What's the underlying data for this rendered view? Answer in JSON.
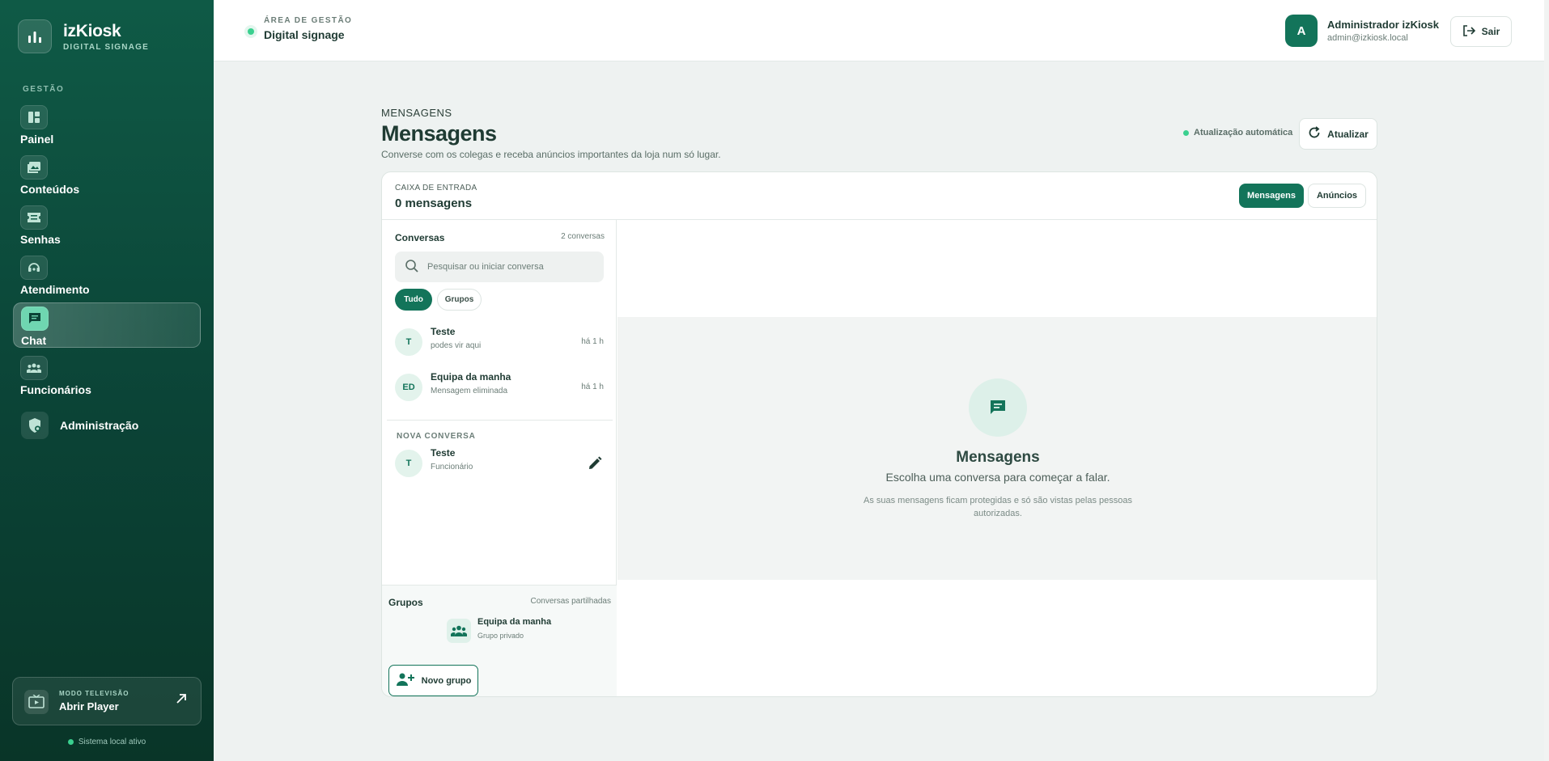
{
  "brand": {
    "name": "izKiosk",
    "subtitle": "DIGITAL SIGNAGE"
  },
  "sidebar": {
    "section_label": "GESTÃO",
    "items": [
      {
        "label": "Painel",
        "icon": "dashboard-icon"
      },
      {
        "label": "Conteúdos",
        "icon": "image-icon"
      },
      {
        "label": "Senhas",
        "icon": "ticket-icon"
      },
      {
        "label": "Atendimento",
        "icon": "headset-icon"
      },
      {
        "label": "Chat",
        "icon": "chat-icon",
        "active": true
      },
      {
        "label": "Funcionários",
        "icon": "people-icon"
      }
    ],
    "admin_label": "Administração",
    "player": {
      "kicker": "MODO TELEVISÃO",
      "label": "Abrir Player"
    },
    "system_status": "Sistema local ativo"
  },
  "topbar": {
    "area_kicker": "ÁREA DE GESTÃO",
    "area_title": "Digital signage",
    "user": {
      "initial": "A",
      "name": "Administrador izKiosk",
      "email": "admin@izkiosk.local"
    },
    "logout_label": "Sair"
  },
  "page": {
    "breadcrumb": "MENSAGENS",
    "title": "Mensagens",
    "subtitle": "Converse com os colegas e receba anúncios importantes da loja num só lugar.",
    "auto_update": "Atualização automática",
    "refresh_label": "Atualizar"
  },
  "inbox": {
    "kicker": "CAIXA DE ENTRADA",
    "count": "0 mensagens",
    "tabs": [
      "Mensagens",
      "Anúncios"
    ]
  },
  "conversations": {
    "title": "Conversas",
    "count": "2 conversas",
    "search_placeholder": "Pesquisar ou iniciar conversa",
    "filters": [
      "Tudo",
      "Grupos"
    ],
    "items": [
      {
        "initials": "T",
        "name": "Teste",
        "preview": "podes vir aqui",
        "time": "há 1 h"
      },
      {
        "initials": "ED",
        "name": "Equipa da manha",
        "preview": "Mensagem eliminada",
        "time": "há 1 h"
      }
    ],
    "new_label": "NOVA CONVERSA",
    "new_items": [
      {
        "initials": "T",
        "name": "Teste",
        "role": "Funcionário"
      }
    ]
  },
  "groups": {
    "title": "Grupos",
    "caption": "Conversas partilhadas",
    "items": [
      {
        "name": "Equipa da manha",
        "type": "Grupo privado"
      }
    ],
    "new_label": "Novo grupo"
  },
  "empty_state": {
    "title": "Mensagens",
    "subtitle": "Escolha uma conversa para começar a falar.",
    "note": "As suas mensagens ficam protegidas e só são vistas pelas pessoas autorizadas."
  },
  "colors": {
    "brand": "#13745a",
    "sidebar": "#0b4336",
    "status": "#3ad08f"
  }
}
